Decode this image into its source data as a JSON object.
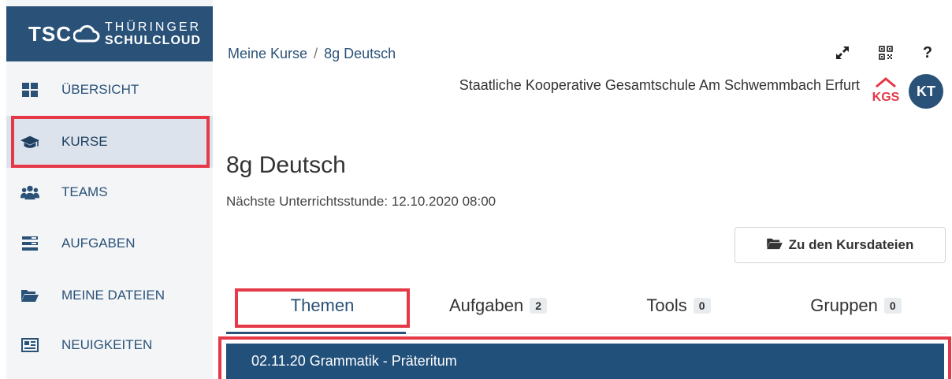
{
  "logo": {
    "short": "TSC",
    "line1": "THÜRINGER",
    "line2": "SCHULCLOUD"
  },
  "sidebar": {
    "items": [
      {
        "label": "ÜBERSICHT",
        "icon": "dashboard-icon"
      },
      {
        "label": "KURSE",
        "icon": "graduation-cap-icon",
        "active": true
      },
      {
        "label": "TEAMS",
        "icon": "users-icon"
      },
      {
        "label": "AUFGABEN",
        "icon": "tasks-icon"
      },
      {
        "label": "MEINE DATEIEN",
        "icon": "folder-open-icon"
      },
      {
        "label": "NEUIGKEITEN",
        "icon": "newspaper-icon"
      }
    ]
  },
  "header": {
    "breadcrumb": {
      "root": "Meine Kurse",
      "separator": "/",
      "current": "8g Deutsch"
    },
    "icons": [
      "expand-icon",
      "qr-code-icon",
      "help-icon"
    ],
    "help_label": "?",
    "school_name": "Staatliche Kooperative Gesamtschule Am Schwemmbach Erfurt",
    "school_logo_text": "KGS",
    "avatar_initials": "KT"
  },
  "course": {
    "title": "8g Deutsch",
    "next_lesson": "Nächste Unterrichtsstunde: 12.10.2020 08:00",
    "files_button": "Zu den Kursdateien"
  },
  "tabs": [
    {
      "label": "Themen",
      "active": true
    },
    {
      "label": "Aufgaben",
      "count": "2"
    },
    {
      "label": "Tools",
      "count": "0"
    },
    {
      "label": "Gruppen",
      "count": "0"
    }
  ],
  "topics": [
    {
      "label": "02.11.20 Grammatik - Präteritum"
    }
  ],
  "colors": {
    "primary": "#2a5278",
    "highlight": "#e53947",
    "sidebar_bg": "#f4f5f7",
    "active_bg": "#dde3ec",
    "topic_bg": "#21507a"
  }
}
